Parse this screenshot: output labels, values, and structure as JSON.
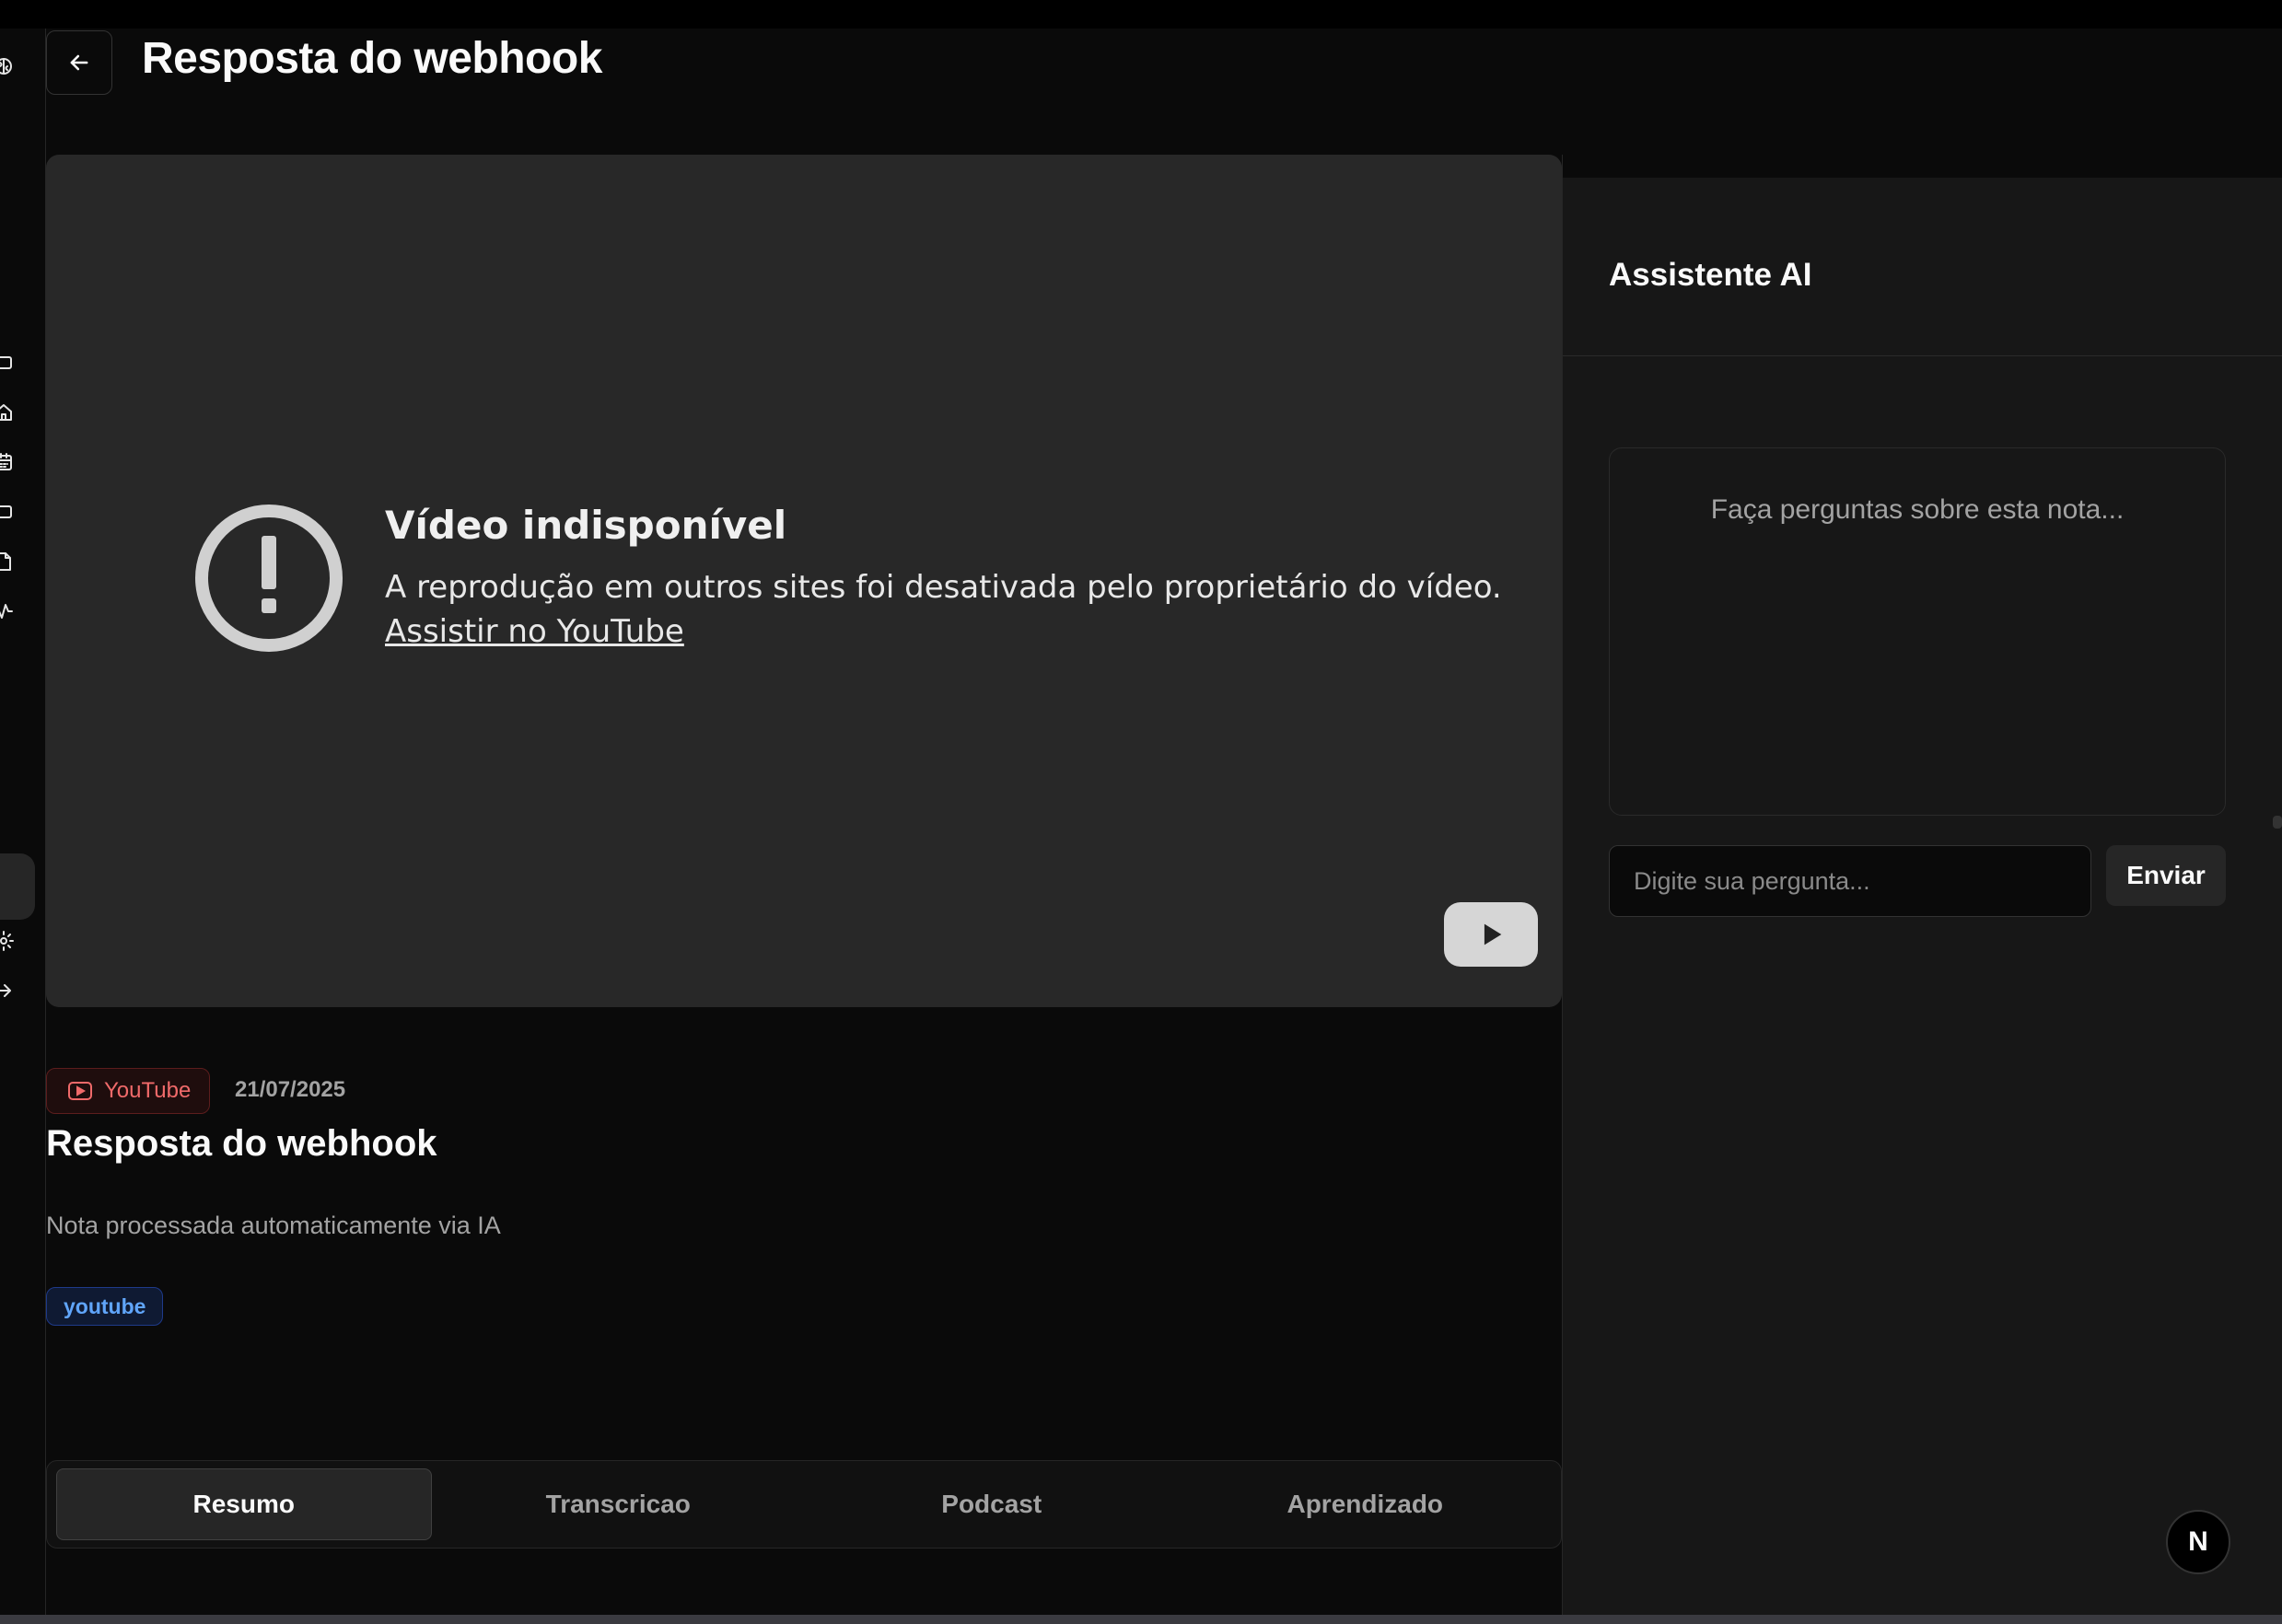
{
  "page": {
    "title": "Resposta do webhook"
  },
  "video": {
    "title": "Vídeo indisponível",
    "message": "A reprodução em outros sites foi desativada pelo proprietário do vídeo.",
    "link_label": "Assistir no YouTube"
  },
  "note": {
    "source_badge": "YouTube",
    "date": "21/07/2025",
    "title": "Resposta do webhook",
    "description": "Nota processada automaticamente via IA",
    "tags": [
      "youtube"
    ]
  },
  "tabs": [
    {
      "label": "Resumo",
      "active": true
    },
    {
      "label": "Transcricao",
      "active": false
    },
    {
      "label": "Podcast",
      "active": false
    },
    {
      "label": "Aprendizado",
      "active": false
    }
  ],
  "assistant": {
    "title": "Assistente AI",
    "empty_text": "Faça perguntas sobre esta nota...",
    "input_placeholder": "Digite sua pergunta...",
    "send_label": "Enviar"
  },
  "badge": {
    "letter": "N"
  },
  "sidebar": {
    "icons": [
      "brain-icon",
      "box-icon",
      "home-icon",
      "calendar-icon",
      "folder-icon",
      "file-icon",
      "activity-icon",
      "gear-icon",
      "logout-icon"
    ],
    "active": "file-icon"
  },
  "colors": {
    "background": "#0a0a0a",
    "panel": "#171717",
    "video_bg": "#282828",
    "youtube_red": "#f06a6a",
    "tag_blue": "#60a5fa"
  }
}
